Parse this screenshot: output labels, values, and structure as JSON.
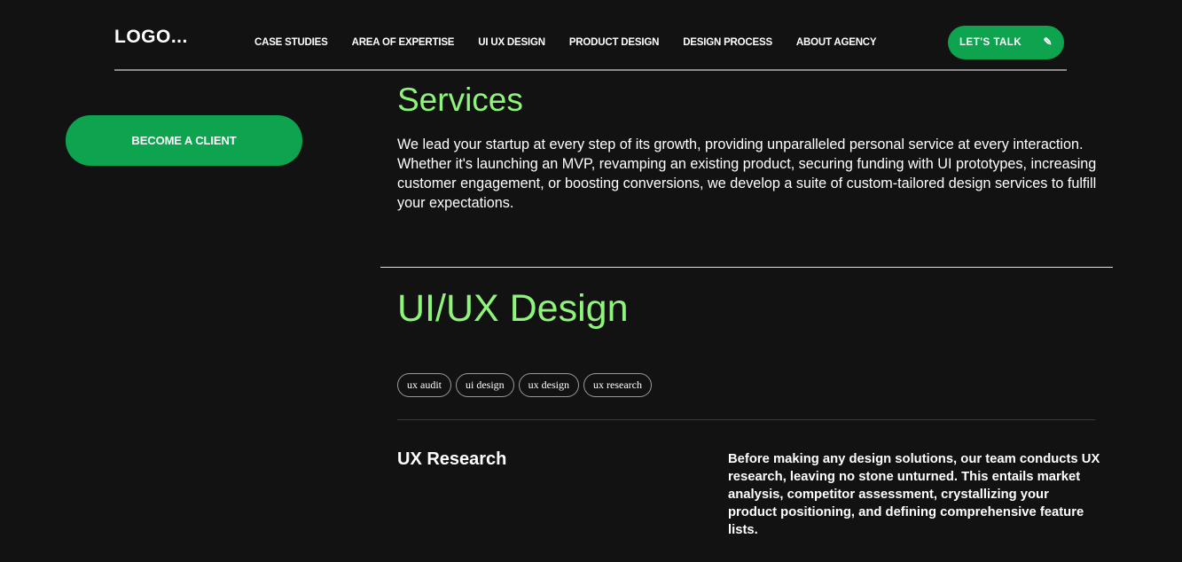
{
  "header": {
    "logo": "LOGO...",
    "nav": [
      "CASE STUDIES",
      "AREA OF EXPERTISE",
      "UI UX DESIGN",
      "PRODUCT DESIGN",
      "DESIGN PROCESS",
      "ABOUT AGENCY"
    ],
    "cta_label": "LET'S TALK"
  },
  "sidebar": {
    "client_button": "BECOME A CLIENT"
  },
  "services": {
    "title": "Services",
    "text": "We lead your startup at every step of its growth, providing unparalleled personal service at every interaction. Whether it's launching an MVP, revamping an existing product, securing funding with UI prototypes, increasing customer engagement, or boosting conversions, we develop a suite of custom-tailored design services to fulfill your expectations."
  },
  "uiux": {
    "title": "UI/UX Design",
    "tags": [
      "ux audit",
      "ui design",
      "ux design",
      "ux research"
    ],
    "subsection": {
      "title": "UX Research",
      "text": "Before making any design solutions, our team conducts UX research, leaving no stone unturned. This entails market analysis, competitor assessment, crystallizing your product positioning, and defining comprehensive feature lists."
    }
  },
  "colors": {
    "accent": "#0ea34f",
    "heading": "#8ef57a",
    "background": "#121212"
  }
}
